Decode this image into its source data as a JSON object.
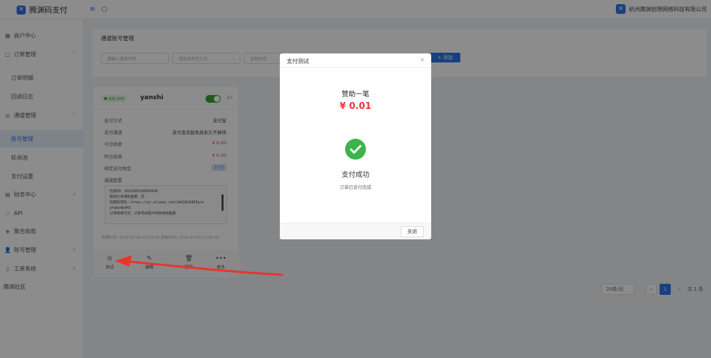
{
  "brand": {
    "name": "腾渊码支付",
    "logo_glyph": "✕"
  },
  "topbar": {
    "menu_glyph": "≡",
    "refresh_glyph": "○",
    "company": "杭州腾渊创想网络科技有限公司"
  },
  "sidebar": {
    "items": [
      {
        "label": "商户中心",
        "icon": "▦"
      },
      {
        "label": "订单管理",
        "icon": "▢",
        "chevron": "^"
      },
      {
        "label": "订单明细"
      },
      {
        "label": "回调日志"
      },
      {
        "label": "通道管理",
        "icon": "◎",
        "chevron": "^"
      },
      {
        "label": "账号管理"
      },
      {
        "label": "轮询池"
      },
      {
        "label": "支付设置"
      },
      {
        "label": "财务中心",
        "icon": "▤",
        "chevron": "v"
      },
      {
        "label": "API",
        "icon": "◌"
      },
      {
        "label": "聚合收款",
        "icon": "◈"
      },
      {
        "label": "账号管理",
        "icon": "👤",
        "chevron": "v"
      },
      {
        "label": "工单系统",
        "icon": "▯",
        "chevron": "v"
      },
      {
        "label": "腾渊社区"
      }
    ]
  },
  "panel": {
    "title": "通道账号管理",
    "filters": [
      {
        "placeholder": "请输入通道名称"
      },
      {
        "placeholder": "请选择支付方式",
        "arrow": "⌄"
      },
      {
        "placeholder": "全部状态",
        "arrow": ""
      }
    ],
    "add_button": "+ 添加"
  },
  "card": {
    "status": "在线 30秒",
    "name": "yanshi",
    "id": "#3",
    "rows": [
      {
        "key": "支付方式",
        "value": "支付宝"
      },
      {
        "key": "支付通道",
        "value": "支付宝无敌免挂永久不掉线"
      },
      {
        "key": "今日收款",
        "value": "¥ 0.00"
      },
      {
        "key": "昨日收款",
        "value": "¥ 0.00"
      },
      {
        "key": "绑定支付类型",
        "value": ""
      },
      {
        "key": "通道配置",
        "value": ""
      }
    ],
    "pay_type_tag": "支付宝",
    "config_lines": [
      "应用ID：2021005166609436",
      "取消订单通知金额：否",
      "收款码地址：https://qr.alipay.com/2m61620483gra",
      "pfqkx4p943",
      "订单核审方式：订单号匹配不到则使用金额"
    ],
    "meta": "创建时间: 2026-07-04 23:39:38  更新时间: 2026-07-04 23:39:38",
    "actions": [
      {
        "label": "测试",
        "icon": "⊙"
      },
      {
        "label": "编辑",
        "icon": "✎"
      },
      {
        "label": "删除",
        "icon": "🗑"
      },
      {
        "label": "更多",
        "icon": "•••"
      }
    ]
  },
  "pagination": {
    "size": "20条/页",
    "prev": "<",
    "current": "1",
    "next": ">",
    "total": "共 1 条"
  },
  "modal": {
    "title": "支付测试",
    "close_glyph": "×",
    "pay_label": "赞助一笔",
    "amount": "¥ 0.01",
    "result_title": "支付成功",
    "result_sub": "订单已支付完成",
    "close_button": "关闭"
  },
  "colors": {
    "accent": "#2f74e6",
    "success": "#3bb54a",
    "danger": "#e63b3b",
    "annotation": "#e8352c"
  }
}
